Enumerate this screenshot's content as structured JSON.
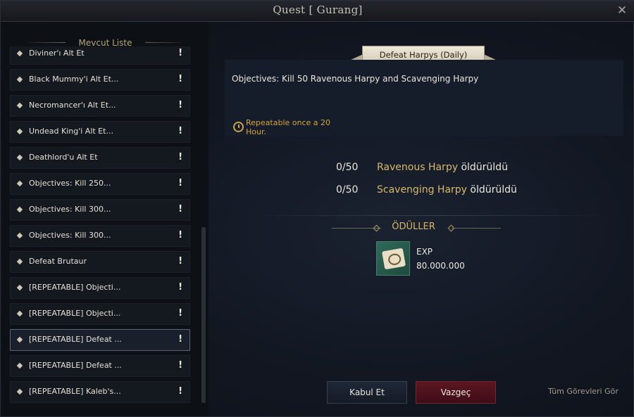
{
  "window": {
    "title": "Quest [ Gurang]"
  },
  "list": {
    "header": "Mevcut Liste",
    "items": [
      {
        "label": "Diviner'ı Alt Et",
        "mark": "!"
      },
      {
        "label": "Black Mummy'i Alt Et...",
        "mark": "!"
      },
      {
        "label": "Necromancer'ı Alt Et...",
        "mark": "!"
      },
      {
        "label": "Undead King'i Alt Et...",
        "mark": "!"
      },
      {
        "label": "Deathlord'u Alt Et",
        "mark": "!"
      },
      {
        "label": "Objectives: Kill 250...",
        "mark": "!"
      },
      {
        "label": "Objectives: Kill 300...",
        "mark": "!"
      },
      {
        "label": "Objectives: Kill 300...",
        "mark": "!"
      },
      {
        "label": "Defeat Brutaur",
        "mark": "!"
      },
      {
        "label": "[REPEATABLE] Objecti...",
        "mark": "!"
      },
      {
        "label": "[REPEATABLE] Objecti...",
        "mark": "!"
      },
      {
        "label": "[REPEATABLE] Defeat ...",
        "mark": "!"
      },
      {
        "label": "[REPEATABLE] Defeat ...",
        "mark": "!"
      },
      {
        "label": "[REPEATABLE] Kaleb's...",
        "mark": "!"
      }
    ],
    "selected_index": 11
  },
  "quest": {
    "title": "Defeat Harpys (Daily)",
    "objective": "Objectives: Kill 50 Ravenous Harpy and Scavenging Harpy",
    "repeat": "Repeatable once a 20 Hour.",
    "progress": [
      {
        "count": "0/50",
        "target": "Ravenous Harpy",
        "verb": "öldürüldü"
      },
      {
        "count": "0/50",
        "target": "Scavenging Harpy",
        "verb": "öldürüldü"
      }
    ]
  },
  "rewards": {
    "title": "ÖDÜLLER",
    "items": [
      {
        "name": "EXP",
        "value": "80.000.000",
        "icon": "scroll-icon"
      }
    ]
  },
  "buttons": {
    "accept": "Kabul Et",
    "cancel": "Vazgeç",
    "all_quests": "Tüm Görevleri Gör"
  }
}
